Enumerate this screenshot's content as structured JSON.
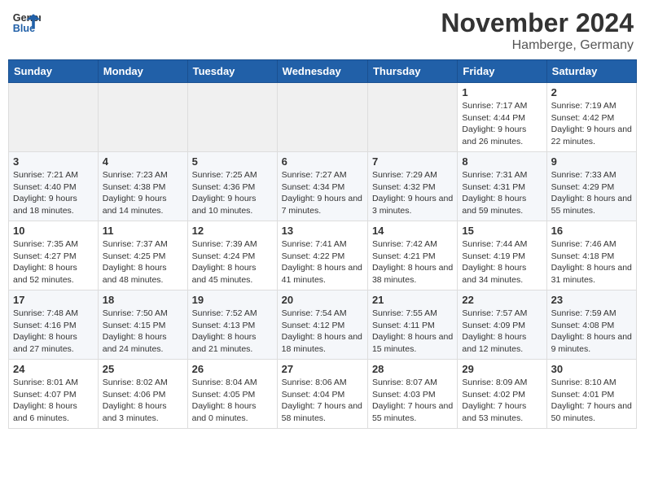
{
  "header": {
    "logo_line1": "General",
    "logo_line2": "Blue",
    "month_title": "November 2024",
    "location": "Hamberge, Germany"
  },
  "calendar": {
    "days_of_week": [
      "Sunday",
      "Monday",
      "Tuesday",
      "Wednesday",
      "Thursday",
      "Friday",
      "Saturday"
    ],
    "weeks": [
      [
        {
          "day": "",
          "info": ""
        },
        {
          "day": "",
          "info": ""
        },
        {
          "day": "",
          "info": ""
        },
        {
          "day": "",
          "info": ""
        },
        {
          "day": "",
          "info": ""
        },
        {
          "day": "1",
          "info": "Sunrise: 7:17 AM\nSunset: 4:44 PM\nDaylight: 9 hours and 26 minutes."
        },
        {
          "day": "2",
          "info": "Sunrise: 7:19 AM\nSunset: 4:42 PM\nDaylight: 9 hours and 22 minutes."
        }
      ],
      [
        {
          "day": "3",
          "info": "Sunrise: 7:21 AM\nSunset: 4:40 PM\nDaylight: 9 hours and 18 minutes."
        },
        {
          "day": "4",
          "info": "Sunrise: 7:23 AM\nSunset: 4:38 PM\nDaylight: 9 hours and 14 minutes."
        },
        {
          "day": "5",
          "info": "Sunrise: 7:25 AM\nSunset: 4:36 PM\nDaylight: 9 hours and 10 minutes."
        },
        {
          "day": "6",
          "info": "Sunrise: 7:27 AM\nSunset: 4:34 PM\nDaylight: 9 hours and 7 minutes."
        },
        {
          "day": "7",
          "info": "Sunrise: 7:29 AM\nSunset: 4:32 PM\nDaylight: 9 hours and 3 minutes."
        },
        {
          "day": "8",
          "info": "Sunrise: 7:31 AM\nSunset: 4:31 PM\nDaylight: 8 hours and 59 minutes."
        },
        {
          "day": "9",
          "info": "Sunrise: 7:33 AM\nSunset: 4:29 PM\nDaylight: 8 hours and 55 minutes."
        }
      ],
      [
        {
          "day": "10",
          "info": "Sunrise: 7:35 AM\nSunset: 4:27 PM\nDaylight: 8 hours and 52 minutes."
        },
        {
          "day": "11",
          "info": "Sunrise: 7:37 AM\nSunset: 4:25 PM\nDaylight: 8 hours and 48 minutes."
        },
        {
          "day": "12",
          "info": "Sunrise: 7:39 AM\nSunset: 4:24 PM\nDaylight: 8 hours and 45 minutes."
        },
        {
          "day": "13",
          "info": "Sunrise: 7:41 AM\nSunset: 4:22 PM\nDaylight: 8 hours and 41 minutes."
        },
        {
          "day": "14",
          "info": "Sunrise: 7:42 AM\nSunset: 4:21 PM\nDaylight: 8 hours and 38 minutes."
        },
        {
          "day": "15",
          "info": "Sunrise: 7:44 AM\nSunset: 4:19 PM\nDaylight: 8 hours and 34 minutes."
        },
        {
          "day": "16",
          "info": "Sunrise: 7:46 AM\nSunset: 4:18 PM\nDaylight: 8 hours and 31 minutes."
        }
      ],
      [
        {
          "day": "17",
          "info": "Sunrise: 7:48 AM\nSunset: 4:16 PM\nDaylight: 8 hours and 27 minutes."
        },
        {
          "day": "18",
          "info": "Sunrise: 7:50 AM\nSunset: 4:15 PM\nDaylight: 8 hours and 24 minutes."
        },
        {
          "day": "19",
          "info": "Sunrise: 7:52 AM\nSunset: 4:13 PM\nDaylight: 8 hours and 21 minutes."
        },
        {
          "day": "20",
          "info": "Sunrise: 7:54 AM\nSunset: 4:12 PM\nDaylight: 8 hours and 18 minutes."
        },
        {
          "day": "21",
          "info": "Sunrise: 7:55 AM\nSunset: 4:11 PM\nDaylight: 8 hours and 15 minutes."
        },
        {
          "day": "22",
          "info": "Sunrise: 7:57 AM\nSunset: 4:09 PM\nDaylight: 8 hours and 12 minutes."
        },
        {
          "day": "23",
          "info": "Sunrise: 7:59 AM\nSunset: 4:08 PM\nDaylight: 8 hours and 9 minutes."
        }
      ],
      [
        {
          "day": "24",
          "info": "Sunrise: 8:01 AM\nSunset: 4:07 PM\nDaylight: 8 hours and 6 minutes."
        },
        {
          "day": "25",
          "info": "Sunrise: 8:02 AM\nSunset: 4:06 PM\nDaylight: 8 hours and 3 minutes."
        },
        {
          "day": "26",
          "info": "Sunrise: 8:04 AM\nSunset: 4:05 PM\nDaylight: 8 hours and 0 minutes."
        },
        {
          "day": "27",
          "info": "Sunrise: 8:06 AM\nSunset: 4:04 PM\nDaylight: 7 hours and 58 minutes."
        },
        {
          "day": "28",
          "info": "Sunrise: 8:07 AM\nSunset: 4:03 PM\nDaylight: 7 hours and 55 minutes."
        },
        {
          "day": "29",
          "info": "Sunrise: 8:09 AM\nSunset: 4:02 PM\nDaylight: 7 hours and 53 minutes."
        },
        {
          "day": "30",
          "info": "Sunrise: 8:10 AM\nSunset: 4:01 PM\nDaylight: 7 hours and 50 minutes."
        }
      ]
    ]
  }
}
